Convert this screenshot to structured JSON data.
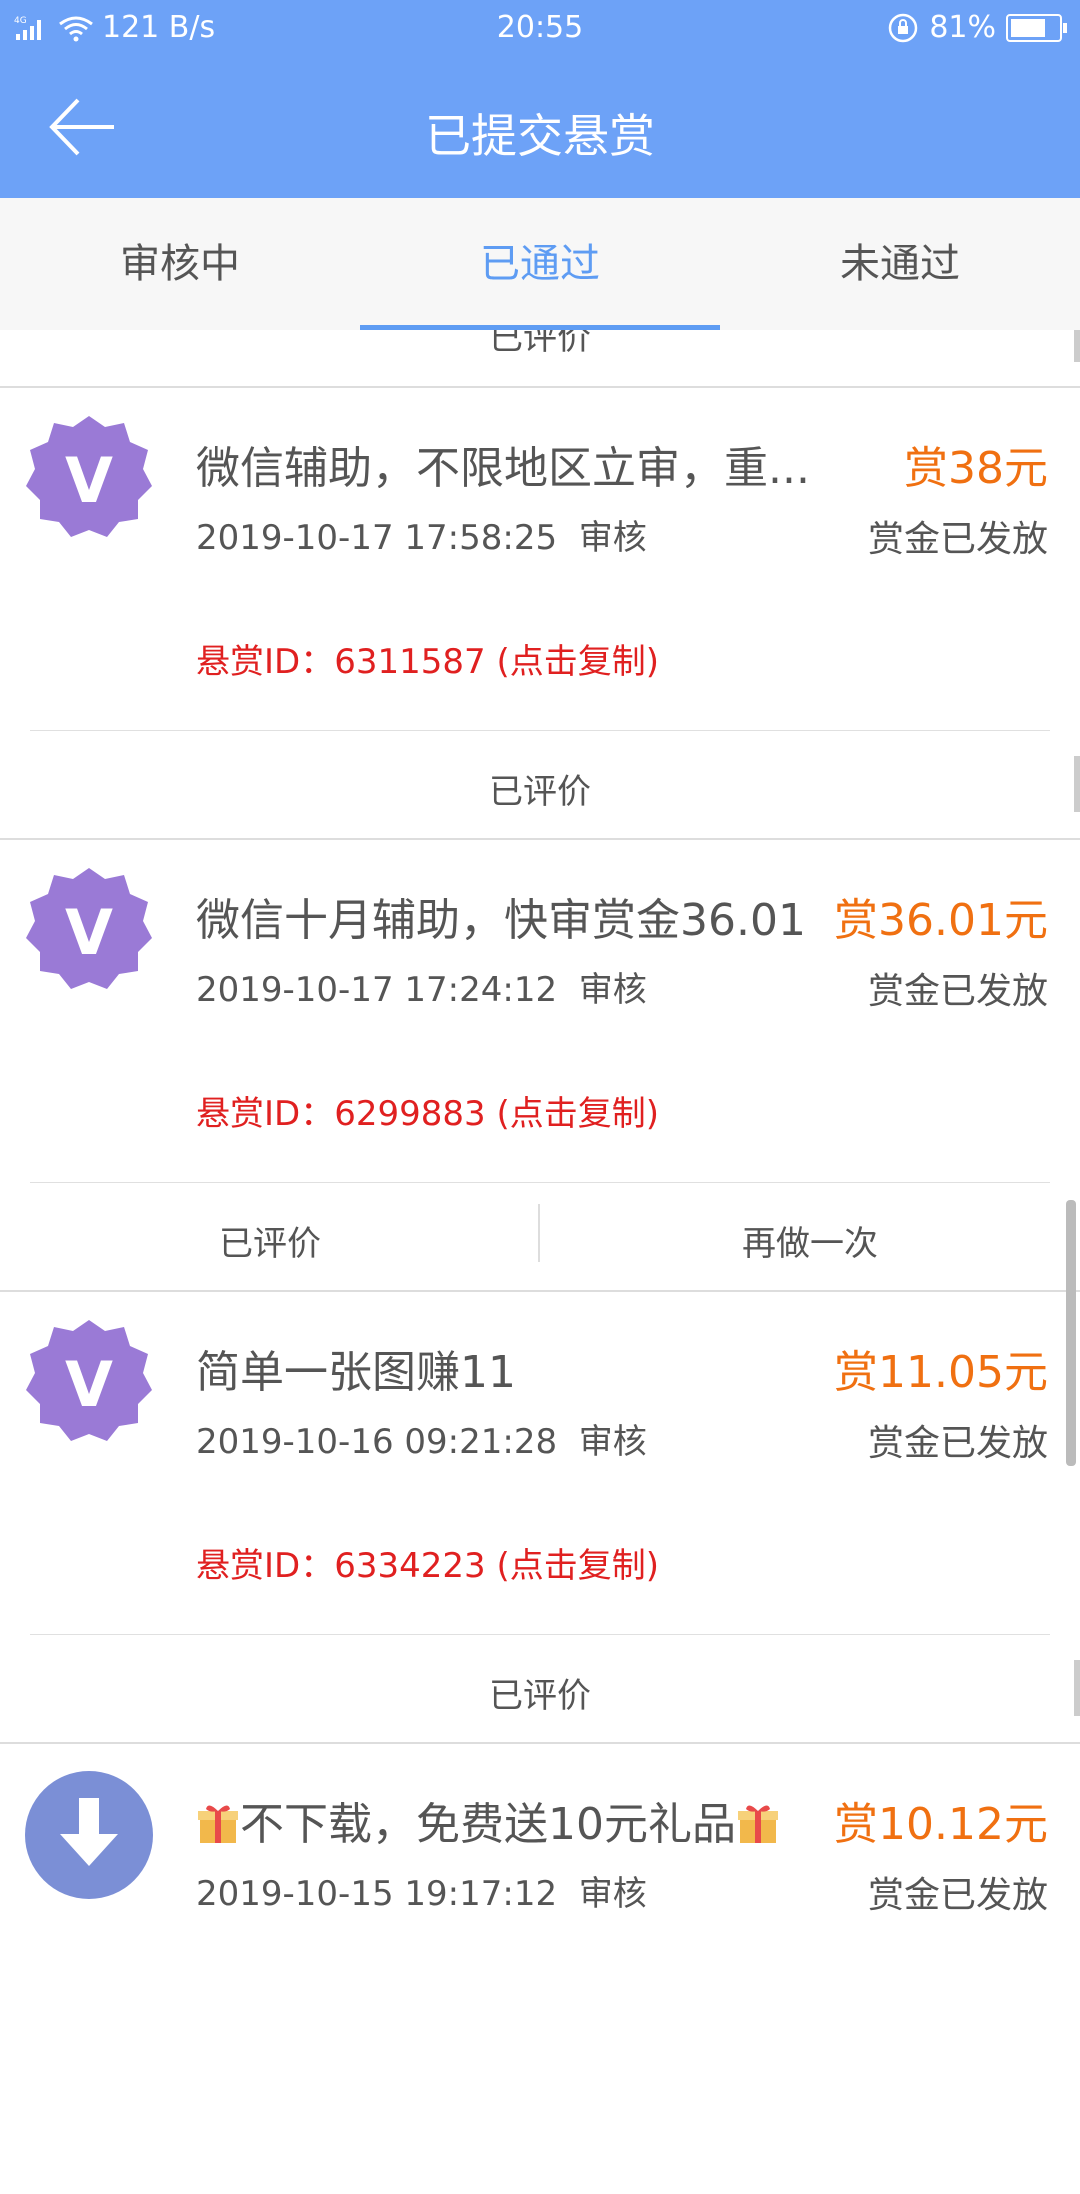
{
  "status_bar": {
    "network": "4G",
    "speed": "121 B/s",
    "time": "20:55",
    "battery": "81%",
    "battery_level": 0.81
  },
  "header": {
    "title": "已提交悬赏"
  },
  "tabs": [
    {
      "label": "审核中"
    },
    {
      "label": "已通过",
      "active": true
    },
    {
      "label": "未通过"
    }
  ],
  "partial_footer": {
    "label": "已评价"
  },
  "cards": [
    {
      "avatar": "v-badge-icon",
      "title": "微信辅助，不限地区立审，重...",
      "reward": "赏38元",
      "date": "2019-10-17 17:58:25",
      "status_tag": "审核",
      "payout": "赏金已发放",
      "id_text": "悬赏ID：6311587 (点击复制)",
      "actions": [
        "已评价"
      ]
    },
    {
      "avatar": "v-badge-icon",
      "title": "微信十月辅助，快审赏金36.01",
      "reward": "赏36.01元",
      "date": "2019-10-17 17:24:12",
      "status_tag": "审核",
      "payout": "赏金已发放",
      "id_text": "悬赏ID：6299883 (点击复制)",
      "actions": [
        "已评价",
        "再做一次"
      ]
    },
    {
      "avatar": "v-badge-icon",
      "title": "简单一张图赚11",
      "reward": "赏11.05元",
      "date": "2019-10-16 09:21:28",
      "status_tag": "审核",
      "payout": "赏金已发放",
      "id_text": "悬赏ID：6334223 (点击复制)",
      "actions": [
        "已评价"
      ]
    },
    {
      "avatar": "download-icon",
      "title": "不下载，免费送10元礼品",
      "reward": "赏10.12元",
      "date": "2019-10-15 19:17:12",
      "status_tag": "审核",
      "payout": "赏金已发放"
    }
  ],
  "colors": {
    "header_bg": "#6da2f7",
    "tab_active": "#5e9cf3",
    "reward": "#f07011",
    "id_text": "#e02020",
    "avatar_purple": "#9a7ad6",
    "avatar_blue": "#7b8fd6"
  }
}
